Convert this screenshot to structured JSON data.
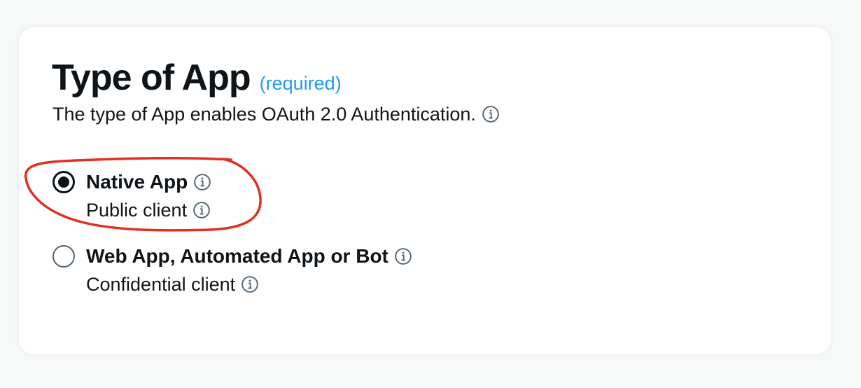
{
  "header": {
    "title": "Type of App",
    "required_label": "(required)",
    "subtitle": "The type of App enables OAuth 2.0 Authentication."
  },
  "options": [
    {
      "label": "Native App",
      "sublabel": "Public client",
      "selected": true
    },
    {
      "label": "Web App, Automated App or Bot",
      "sublabel": "Confidential client",
      "selected": false
    }
  ],
  "icons": {
    "info": "info-circle-icon"
  },
  "colors": {
    "accent": "#1d9bf0",
    "text": "#0f1419",
    "annotation": "#e0301e"
  }
}
